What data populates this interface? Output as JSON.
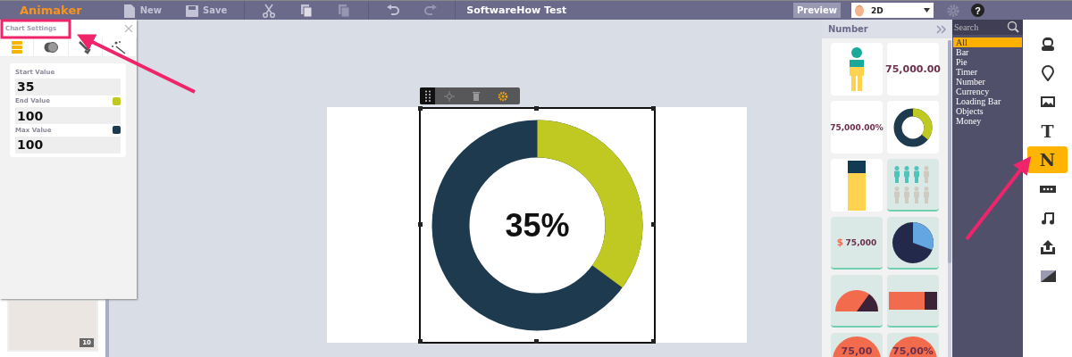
{
  "toolbar": {
    "logo": "Animaker",
    "buttons": [
      {
        "kind": "new",
        "label": "New",
        "disabled": false
      },
      {
        "kind": "save",
        "label": "Save",
        "disabled": false
      },
      {
        "kind": "cut",
        "disabled": false
      },
      {
        "kind": "copy",
        "disabled": false
      },
      {
        "kind": "paste",
        "disabled": true
      },
      {
        "kind": "undo",
        "disabled": false
      },
      {
        "kind": "redo",
        "disabled": true
      }
    ],
    "project_title": "SoftwareHow Test",
    "preview_button": "Preview",
    "mode_dropdown": {
      "value": "2D"
    },
    "help_button": "?"
  },
  "chart_settings": {
    "title": "Chart Settings",
    "tabs": [
      {
        "kind": "data",
        "selected": true
      },
      {
        "kind": "colors",
        "selected": false
      },
      {
        "kind": "tools",
        "selected": false
      },
      {
        "kind": "effects",
        "selected": false
      }
    ],
    "fields": [
      {
        "label": "Start Value",
        "value": "35"
      },
      {
        "label": "End Value",
        "value": "100",
        "color": "#c0c822"
      },
      {
        "label": "Max Value",
        "value": "100",
        "color": "#1e3a4f"
      }
    ]
  },
  "slides": [
    {
      "number": "10"
    }
  ],
  "chart": {
    "label": "35%",
    "level": 0.35
  },
  "element_panel": {
    "title": "Number",
    "items": [
      {
        "kind": "figure"
      },
      {
        "kind": "number",
        "text": "75,000.00"
      },
      {
        "kind": "percent",
        "text": "75,000.00%"
      },
      {
        "kind": "donut"
      },
      {
        "kind": "bar"
      },
      {
        "kind": "people"
      },
      {
        "kind": "currency",
        "symbol": "$",
        "text": "75,000"
      },
      {
        "kind": "pie"
      },
      {
        "kind": "gauge"
      },
      {
        "kind": "progress"
      },
      {
        "kind": "circle",
        "text": "75,00"
      },
      {
        "kind": "circle",
        "text": "75,00%"
      }
    ]
  },
  "categories": {
    "search_placeholder": "Search",
    "items": [
      {
        "label": "All",
        "selected": true
      },
      {
        "label": "Bar",
        "selected": false
      },
      {
        "label": "Pie",
        "selected": false
      },
      {
        "label": "Timer",
        "selected": false
      },
      {
        "label": "Number",
        "selected": false
      },
      {
        "label": "Currency",
        "selected": false
      },
      {
        "label": "Loading Bar",
        "selected": false
      },
      {
        "label": "Objects",
        "selected": false
      },
      {
        "label": "Money",
        "selected": false
      }
    ]
  },
  "tool_rail": [
    {
      "kind": "character",
      "selected": false
    },
    {
      "kind": "pin",
      "selected": false
    },
    {
      "kind": "image",
      "selected": false
    },
    {
      "kind": "letter",
      "label": "T",
      "selected": false
    },
    {
      "kind": "letter",
      "label": "N",
      "selected": true
    },
    {
      "kind": "badge",
      "selected": false
    },
    {
      "kind": "music",
      "selected": false
    },
    {
      "kind": "upload",
      "selected": false
    },
    {
      "kind": "gradient",
      "selected": false
    }
  ]
}
